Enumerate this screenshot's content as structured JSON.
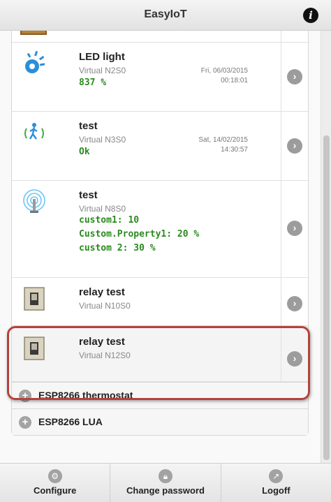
{
  "app": {
    "title": "EasyIoT"
  },
  "devices": [
    {
      "name": "LED light",
      "node": "Virtual N2S0",
      "values": [
        "837 %"
      ],
      "date": "Fri, 06/03/2015",
      "time": "00:18:01",
      "icon": "bulb-icon"
    },
    {
      "name": "test",
      "node": "Virtual N3S0",
      "values": [
        "Ok"
      ],
      "date": "Sat, 14/02/2015",
      "time": "14:30:57",
      "icon": "motion-sensor-icon"
    },
    {
      "name": "test",
      "node": "Virtual N8S0",
      "values": [
        "custom1: 10",
        "Custom.Property1: 20 %",
        "custom 2: 30 %"
      ],
      "icon": "antenna-icon"
    },
    {
      "name": "relay test",
      "node": "Virtual N10S0",
      "values": [],
      "icon": "switch-icon"
    },
    {
      "name": "relay test",
      "node": "Virtual N12S0",
      "values": [],
      "icon": "switch-icon"
    }
  ],
  "groups": [
    {
      "label": "ESP8266 thermostat"
    },
    {
      "label": "ESP8266 LUA"
    }
  ],
  "footer": {
    "configure": "Configure",
    "change_password": "Change password",
    "logoff": "Logoff"
  }
}
